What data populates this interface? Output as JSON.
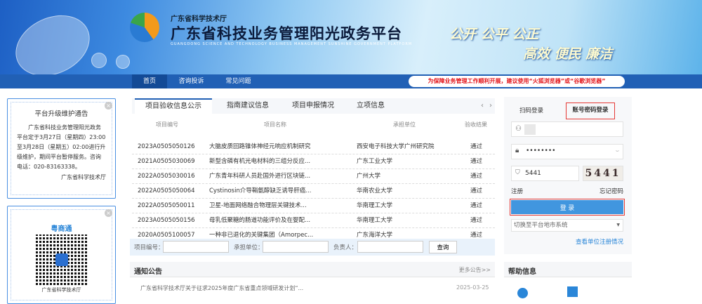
{
  "header": {
    "org": "广东省科学技术厅",
    "title": "广东省科技业务管理阳光政务平台",
    "title_en": "GUANGDONG SCIENCE AND TECHNOLOGY BUSINESS MANAGEMENT SUNSHINE GOVERNMENT PLATFORM",
    "slogan1": "公开  公平  公正",
    "slogan2": "高效  便民  廉洁"
  },
  "nav": {
    "items": [
      "首页",
      "咨询投诉",
      "常见问题"
    ],
    "notice": "为保障业务管理工作顺利开展，建议使用“火狐浏览器”或“谷歌浏览器”"
  },
  "colors": {
    "nav": "#2160b5",
    "accent": "#4196df",
    "highlight": "#e53935"
  },
  "left": {
    "notice_title": "平台升级维护通告",
    "notice_body": "广东省科技业务管理阳光政务平台定于3月27日（星期四）23:00至3月28日（星期五）02:00进行升级维护，期间平台暂停服务。咨询电话：020-83163338。",
    "notice_sign": "广东省科学技术厅",
    "qr_title": "粤商通",
    "qr_caption": "广东省科学技术厅"
  },
  "main": {
    "tabs": [
      "项目验收信息公示",
      "指南建议信息",
      "项目申报情况",
      "立项信息"
    ],
    "columns": [
      "项目编号",
      "项目名称",
      "承担单位",
      "验收结果"
    ],
    "rows": [
      [
        "2023A0505050126",
        "大脑皮质回路锥体神经元响应机制研究",
        "西安电子科技大学广州研究院",
        "通过"
      ],
      [
        "2021A0505030069",
        "新型含磷有机光电材料的三组分反应...",
        "广东工业大学",
        "通过"
      ],
      [
        "2022A0505030016",
        "广东青年科研人员赴国外进行区块链...",
        "广州大学",
        "通过"
      ],
      [
        "2022A0505050064",
        "Cystinosin介导鞘氨醇缺乏诱导肝癌...",
        "华南农业大学",
        "通过"
      ],
      [
        "2022A0505050011",
        "卫星-地面网络融合物理层关键技术...",
        "华南理工大学",
        "通过"
      ],
      [
        "2023A0505050156",
        "母乳低聚糖的肠道功能评价及在婴配...",
        "华南理工大学",
        "通过"
      ],
      [
        "2020A0505100057",
        "一种非已退化的关键集团（Amorpec...",
        "广东海洋大学",
        "通过"
      ]
    ],
    "search": {
      "label1": "项目编号：",
      "label2": "承担单位：",
      "label3": "负责人：",
      "button": "查询"
    },
    "notices_title": "通知公告",
    "more": "更多公告>>",
    "notices": [
      {
        "title": "广东省科学技术厅关于征求2025年度广东省重点领域研发计划“...",
        "date": "2025-03-25"
      }
    ]
  },
  "login": {
    "tab_qr": "扫码登录",
    "tab_account": "账号密码登录",
    "username": "",
    "password": "••••••••",
    "captcha": "5441",
    "captcha_image": "5441",
    "register": "注册",
    "forgot": "忘记密码",
    "login_button": "登 录",
    "switch_select": "切换至平台地市系统",
    "unit_link": "查看单位注册情况"
  },
  "help": {
    "title": "帮助信息"
  }
}
